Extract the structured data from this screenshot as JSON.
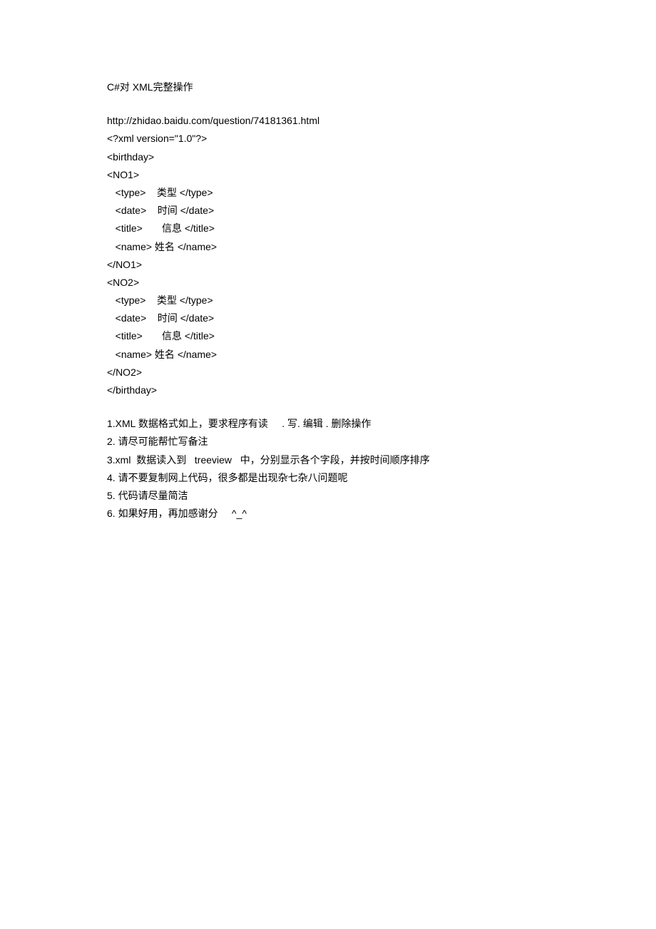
{
  "title": "C#对 XML完整操作",
  "url": "http://zhidao.baidu.com/question/74181361.html",
  "xml_lines": [
    "<?xml version=\"1.0\"?>",
    "<birthday>",
    "<NO1>",
    "   <type>    类型 </type>",
    "   <date>    时间 </date>",
    "   <title>       信息 </title>",
    "   <name> 姓名 </name>",
    "</NO1>",
    "<NO2>",
    "   <type>    类型 </type>",
    "   <date>    时间 </date>",
    "   <title>       信息 </title>",
    "   <name> 姓名 </name>",
    "</NO2>",
    "</birthday>"
  ],
  "requirements": [
    "1.XML 数据格式如上，要求程序有读     . 写. 编辑 . 删除操作",
    "2. 请尽可能帮忙写备注",
    "3.xml  数据读入到   treeview   中，分别显示各个字段，并按时间顺序排序",
    "4. 请不要复制网上代码，很多都是出现杂七杂八问题呢",
    "5. 代码请尽量简洁",
    "6. 如果好用，再加感谢分     ^_^"
  ]
}
